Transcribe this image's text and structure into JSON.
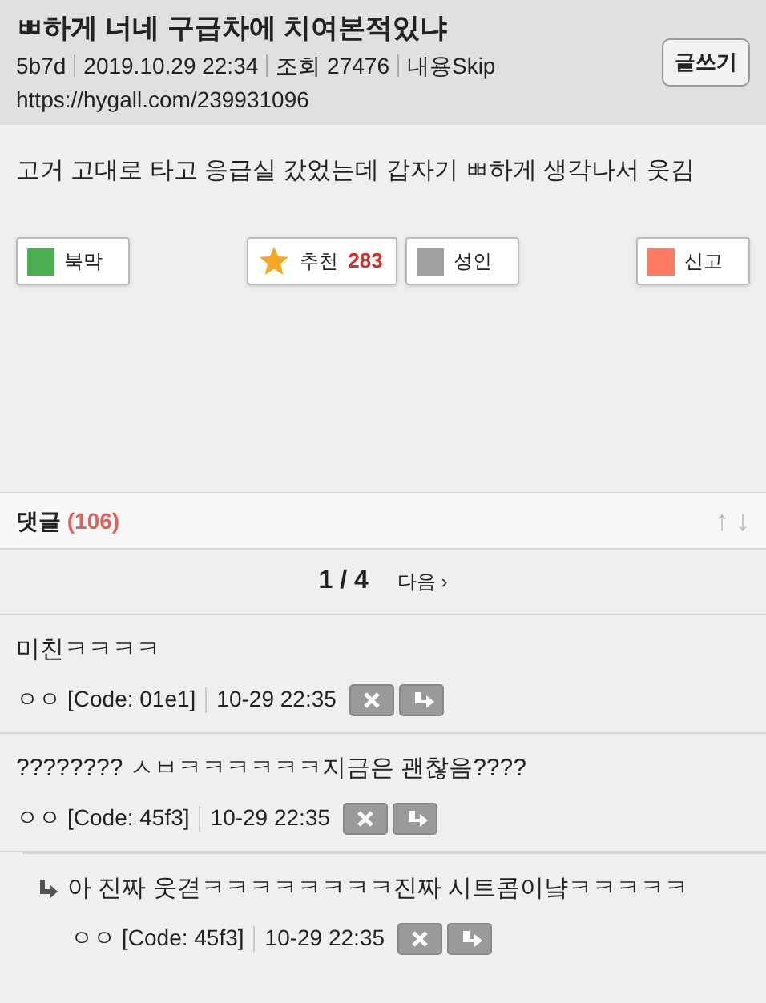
{
  "post": {
    "title": "ㅃ하게 너네 구급차에 치여본적있냐",
    "meta": [
      "5b7d",
      "2019.10.29 22:34",
      "조회 27476",
      "내용Skip"
    ],
    "url": "https://hygall.com/239931096",
    "write_button": "글쓰기",
    "body": "고거 고대로 타고 응급실 갔었는데 갑자기 ㅃ하게 생각나서 웃김"
  },
  "actions": [
    {
      "kind": "square",
      "label": "북막",
      "color": "#4caf50"
    },
    {
      "kind": "star",
      "label": "추천",
      "count": "283"
    },
    {
      "kind": "square",
      "label": "성인",
      "color": "#a0a0a0"
    },
    {
      "kind": "square",
      "label": "신고",
      "color": "#ff7b63"
    }
  ],
  "comments_header": {
    "label": "댓글",
    "count": "(106)",
    "sort_up": "↑",
    "sort_down": "↓"
  },
  "pager": {
    "page": "1 / 4",
    "next": "다음 ›"
  },
  "comments": [
    {
      "text": "미친ㅋㅋㅋㅋ",
      "author": "ㅇㅇ",
      "code": "[Code: 01e1]",
      "time": "10-29 22:35"
    },
    {
      "text": "???????? ㅅㅂㅋㅋㅋㅋㅋㅋ지금은 괜찮음????",
      "author": "ㅇㅇ",
      "code": "[Code: 45f3]",
      "time": "10-29 22:35",
      "children": [
        {
          "text": "아 진짜 웃겯ㅋㅋㅋㅋㅋㅋㅋㅋ진짜 시트콤이냨ㅋㅋㅋㅋㅋ",
          "author": "ㅇㅇ",
          "code": "[Code: 45f3]",
          "time": "10-29 22:35"
        }
      ]
    }
  ]
}
